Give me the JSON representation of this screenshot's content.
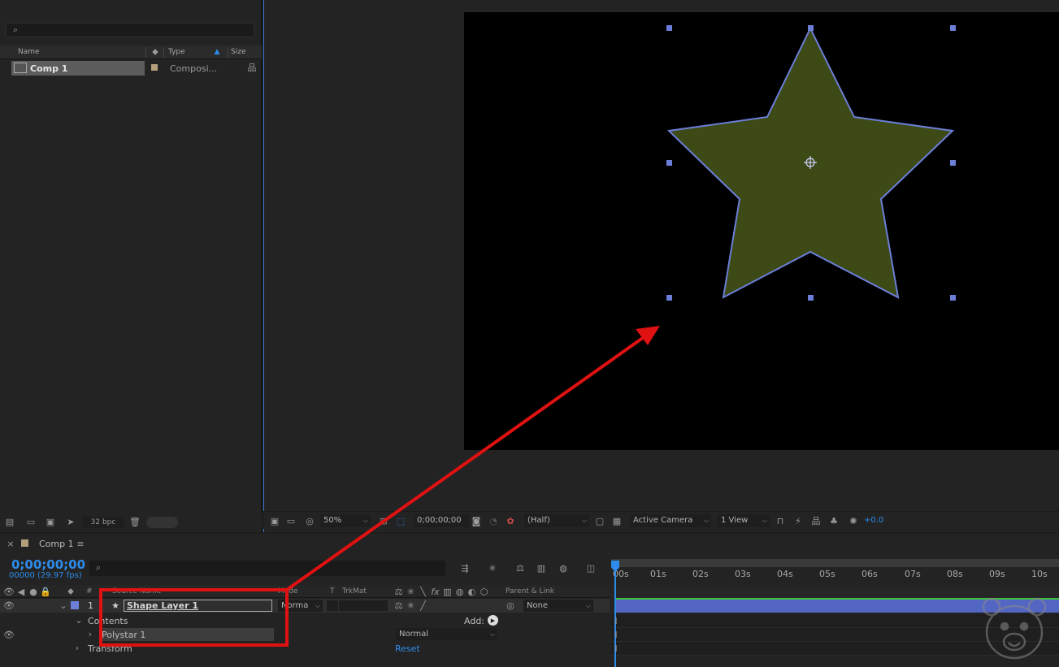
{
  "project": {
    "search_placeholder": "",
    "columns": {
      "name": "Name",
      "type": "Type",
      "size": "Size"
    },
    "items": [
      {
        "name": "Comp 1",
        "type": "Composi...",
        "label_color": "#b59f7a"
      }
    ],
    "bpc": "32 bpc"
  },
  "viewer": {
    "zoom": "50%",
    "timecode": "0;00;00;00",
    "resolution": "(Half)",
    "camera": "Active Camera",
    "views": "1 View",
    "exposure": "+0.0",
    "star_fill": "#3d4a16",
    "star_stroke": "#6b7fd8"
  },
  "timeline": {
    "comp_tab": "Comp 1",
    "timecode": "0;00;00;00",
    "fps": "00000 (29.97 fps)",
    "columns": {
      "num": "#",
      "source_name": "Source Name",
      "mode": "Mode",
      "t": "T",
      "trkmat": "TrkMat",
      "parent": "Parent & Link"
    },
    "layer": {
      "number": "1",
      "name": "Shape Layer 1",
      "mode": "Norma",
      "parent": "None",
      "label_color": "#6b7fd8"
    },
    "contents_label": "Contents",
    "add_label": "Add:",
    "polystar": {
      "name": "Polystar 1",
      "blend": "Normal"
    },
    "transform": {
      "name": "Transform",
      "reset": "Reset"
    },
    "ruler": [
      "00s",
      "01s",
      "02s",
      "03s",
      "04s",
      "05s",
      "06s",
      "07s",
      "08s",
      "09s",
      "10s"
    ]
  },
  "annotation_color": "#e01111"
}
